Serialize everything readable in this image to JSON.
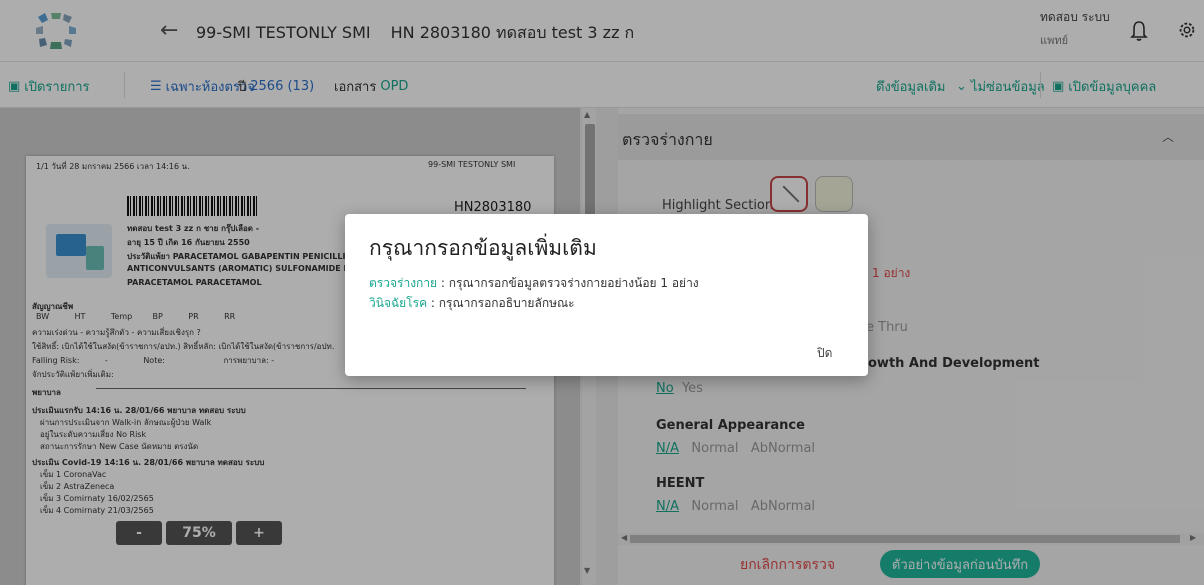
{
  "header": {
    "title": "99-SMI TESTONLY SMI",
    "hn": "HN 2803180 ทดสอบ test 3 zz ก",
    "user_name": "ทดสอบ ระบบ",
    "user_role": "แพทย์"
  },
  "toolbar": {
    "open_list": "เปิดรายการ",
    "filter_label": "เฉพาะห้องตรวจ",
    "year_label": "ปี",
    "year_value": "2566 (13)",
    "doc_label": "เอกสาร",
    "doc_value": "OPD",
    "pull_data": "ดึงข้อมูลเดิม",
    "show_data": "ไม่ซ่อนข้อมูล",
    "open_person": "เปิดข้อมูลบุคคล"
  },
  "document": {
    "page_date": "1/1  วันที่ 28 มกราคม 2566  เวลา 14:16 น.",
    "doc_title": "99-SMI TESTONLY SMI",
    "doc_hn": "HN2803180",
    "patient_line1": "ทดสอบ test 3 zz ก  ชาย  กรุ๊ปเลือด -",
    "patient_line2": "อายุ 15 ปี  เกิด 16 กันยายน 2550",
    "patient_line3": "ประวัติแพ้ยา PARACETAMOL GABAPENTIN PENICILLIN",
    "patient_line4": "ANTICONVULSANTS (AROMATIC) SULFONAMIDE PAR",
    "patient_line5": "PARACETAMOL PARACETAMOL",
    "vital_title": "สัญญาณชีพ",
    "vital_cols": "BW          HT          Temp        BP          PR          RR",
    "line_urgent": "ความเร่งด่วน -  ความรู้สึกตัว -  ความเสี่ยงเชิงรุก ?",
    "line_rights": "ใช้สิทธิ์: เบิกได้ใช้ในสงัด(ข้าราชการ/อปท.)  สิทธิ์หลัก: เบิกได้ใช้ในสงัด(ข้าราชการ/อปท.",
    "line_fall": "Falling Risk:          -              Note:                       การพยาบาล: -",
    "line_drug": "จักประวัติแพ้ยาเพิ่มเติม:",
    "nurse_title": "พยาบาล",
    "eval_title": "ประเมินแรกรับ 14:16 น. 28/01/66 พยาบาล ทดสอบ ระบบ",
    "eval_1": "ผ่านการประเมินจาก Walk-in  ลักษณะผู้ป่วย Walk",
    "eval_2": "อยู่ในระดับความเสี่ยง No Risk",
    "eval_3": "สถานะการรักษา New Case  นัดหมาย ตรงนัด",
    "covid_title": "ประเมิน Covid-19  14:16 น. 28/01/66 พยาบาล ทดสอบ ระบบ",
    "covid_1": "เข็ม 1 CoronaVac",
    "covid_2": "เข็ม 2 AstraZeneca",
    "covid_3": "เข็ม 3 Comirnaty 16/02/2565",
    "covid_4": "เข็ม 4 Comirnaty 21/03/2565"
  },
  "zoom": {
    "minus": "-",
    "value": "75%",
    "plus": "+"
  },
  "exam": {
    "title": "ตรวจร่างกาย",
    "highlight_label": "Highlight Section",
    "partial_red": "1 อย่าง",
    "partial_thru": "e Thru",
    "partial_growth": "owth And Development",
    "no": "No",
    "yes": "Yes",
    "general_title": "General Appearance",
    "heent_title": "HEENT",
    "na": "N/A",
    "normal": "Normal",
    "abnormal": "AbNormal"
  },
  "footer": {
    "cancel": "ยกเลิกการตรวจ",
    "preview": "ตัวอย่างข้อมูลก่อนบันทึก"
  },
  "modal": {
    "title": "กรุณากรอกข้อมูลเพิ่มเติม",
    "item1_link": "ตรวจร่างกาย",
    "item1_text": " : กรุณากรอกข้อมูลตรวจร่างกายอย่างน้อย 1 อย่าง",
    "item2_link": "วินิจฉัยโรค",
    "item2_text": " : กรุณากรอกอธิบายลักษณะ",
    "close": "ปิด"
  },
  "colors": {
    "accent": "#20b79d",
    "link_teal": "#18a78f",
    "danger": "#e04848"
  }
}
